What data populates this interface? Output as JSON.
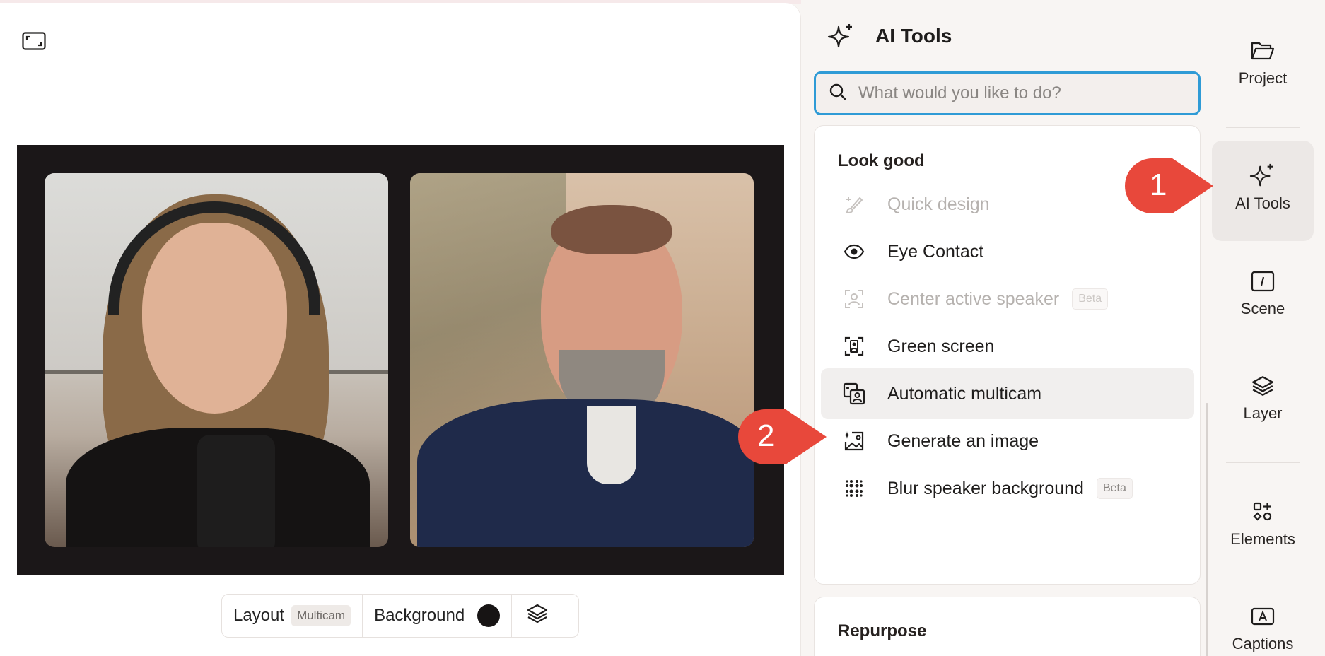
{
  "canvas": {
    "layout_label": "Layout",
    "layout_value": "Multicam",
    "background_label": "Background",
    "background_color": "#171414"
  },
  "panel": {
    "title": "AI Tools",
    "search_placeholder": "What would you like to do?",
    "sections": [
      {
        "title": "Look good",
        "tools": [
          {
            "label": "Quick design",
            "icon": "paintbrush-sparkle-icon",
            "disabled": true
          },
          {
            "label": "Eye Contact",
            "icon": "eye-icon",
            "disabled": false
          },
          {
            "label": "Center active speaker",
            "icon": "center-speaker-icon",
            "disabled": true,
            "badge": "Beta"
          },
          {
            "label": "Green screen",
            "icon": "person-frame-icon",
            "disabled": false
          },
          {
            "label": "Automatic multicam",
            "icon": "multicam-icon",
            "disabled": false,
            "active": true
          },
          {
            "label": "Generate an image",
            "icon": "image-sparkle-icon",
            "disabled": false
          },
          {
            "label": "Blur speaker background",
            "icon": "blur-dots-icon",
            "disabled": false,
            "badge": "Beta"
          }
        ]
      },
      {
        "title": "Repurpose"
      }
    ]
  },
  "rail": [
    {
      "label": "Project",
      "icon": "folder-icon"
    },
    {
      "label": "AI Tools",
      "icon": "sparkle-icon",
      "active": true
    },
    {
      "label": "Scene",
      "icon": "scene-icon"
    },
    {
      "label": "Layer",
      "icon": "layers-icon"
    },
    {
      "label": "Elements",
      "icon": "elements-icon"
    },
    {
      "label": "Captions",
      "icon": "captions-icon"
    }
  ],
  "callouts": [
    "1",
    "2"
  ],
  "colors": {
    "accent": "#2f9bd6",
    "callout": "#e8483b"
  }
}
